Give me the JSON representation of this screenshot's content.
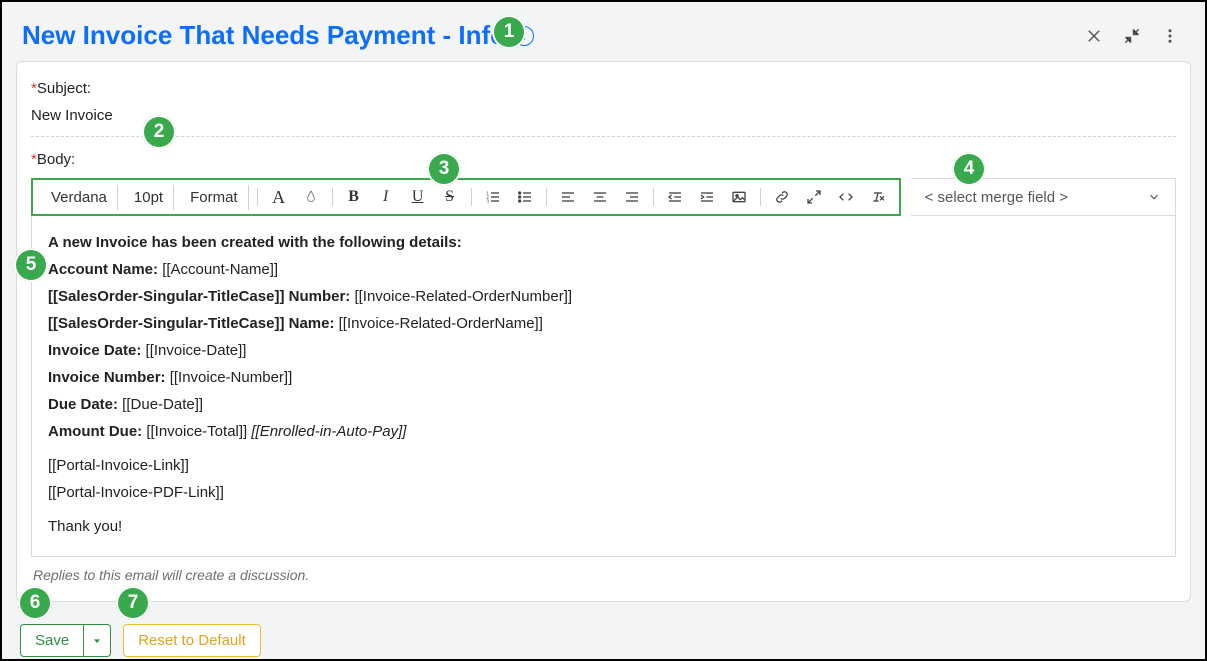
{
  "header": {
    "title": "New Invoice That Needs Payment - Info"
  },
  "subject": {
    "label": "Subject:",
    "value": "New Invoice"
  },
  "body": {
    "label": "Body:"
  },
  "toolbar": {
    "font": "Verdana",
    "size": "10pt",
    "format": "Format",
    "mergeField": "< select merge field >"
  },
  "editor": {
    "l1": "A new Invoice has been created with the following details:",
    "l2a": "Account Name:",
    "l2b": " [[Account-Name]]",
    "l3a": "[[SalesOrder-Singular-TitleCase]] Number:",
    "l3b": " [[Invoice-Related-OrderNumber]]",
    "l4a": "[[SalesOrder-Singular-TitleCase]] Name:",
    "l4b": " [[Invoice-Related-OrderName]]",
    "l5a": "Invoice Date:",
    "l5b": " [[Invoice-Date]]",
    "l6a": "Invoice Number:",
    "l6b": " [[Invoice-Number]]",
    "l7a": "Due Date:",
    "l7b": " [[Due-Date]]",
    "l8a": "Amount Due:",
    "l8b": " [[Invoice-Total]] ",
    "l8c": "[[Enrolled-in-Auto-Pay]]",
    "l9": " [[Portal-Invoice-Link]]",
    "l10": "[[Portal-Invoice-PDF-Link]]",
    "l11": "Thank you!"
  },
  "note": "Replies to this email will create a discussion.",
  "buttons": {
    "save": "Save",
    "reset": "Reset to Default"
  },
  "callouts": {
    "c1": "1",
    "c2": "2",
    "c3": "3",
    "c4": "4",
    "c5": "5",
    "c6": "6",
    "c7": "7"
  }
}
